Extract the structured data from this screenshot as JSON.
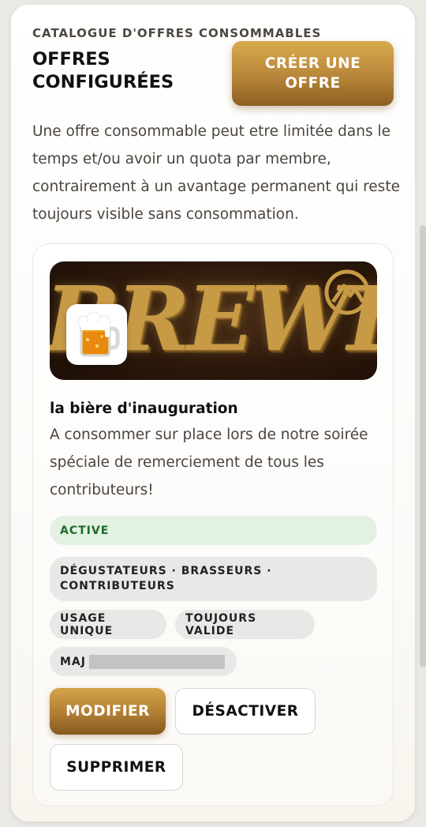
{
  "header": {
    "eyebrow": "CATALOGUE D'OFFRES CONSOMMABLES",
    "title": "OFFRES CONFIGURÉES",
    "create_button": "CRÉER UNE OFFRE"
  },
  "intro": "Une offre consommable peut etre limitée dans le temps et/ou avoir un quota par membre, contrairement à un avantage permanent qui reste toujours visible sans consommation.",
  "offer": {
    "banner_text": "BREWERS",
    "emoji": "🍺",
    "name": "la bière d'inauguration",
    "description": "A consommer sur place lors de notre soirée spéciale de remerciement de tous les contributeurs!",
    "status": "ACTIVE",
    "audience": "DÉGUSTATEURS · BRASSEURS · CONTRIBUTEURS",
    "usage": "USAGE UNIQUE",
    "validity": "TOUJOURS VALIDE",
    "updated_label": "MAJ",
    "actions": {
      "edit": "MODIFIER",
      "disable": "DÉSACTIVER",
      "delete": "SUPPRIMER"
    }
  },
  "colors": {
    "accent_gold": "#b8863a",
    "status_green": "#1f6b2a",
    "status_bg": "#e2f1e2"
  }
}
